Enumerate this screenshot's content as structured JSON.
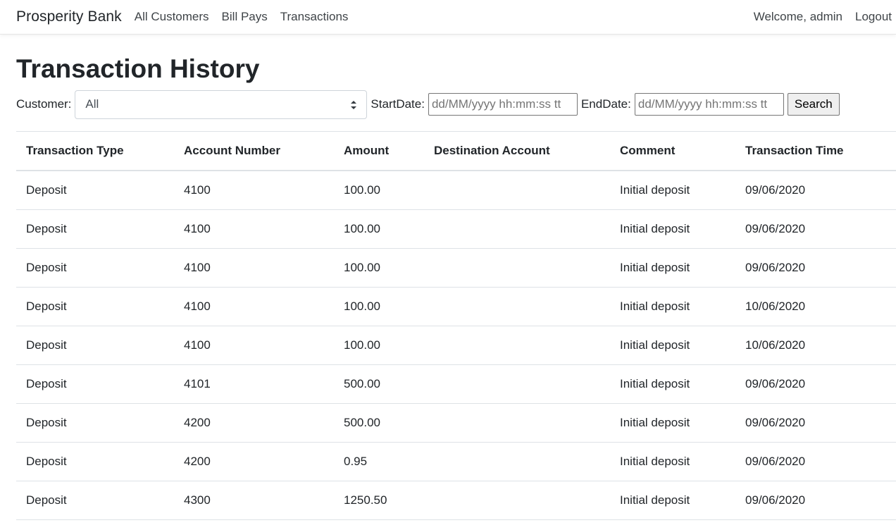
{
  "navbar": {
    "brand": "Prosperity Bank",
    "links": [
      "All Customers",
      "Bill Pays",
      "Transactions"
    ],
    "welcome": "Welcome, admin",
    "logout": "Logout"
  },
  "page": {
    "title": "Transaction History"
  },
  "filters": {
    "customer_label": "Customer:",
    "customer_selected": "All",
    "start_label": "StartDate:",
    "start_placeholder": "dd/MM/yyyy hh:mm:ss tt",
    "end_label": "EndDate:",
    "end_placeholder": "dd/MM/yyyy hh:mm:ss tt",
    "search_label": "Search"
  },
  "table": {
    "headers": [
      "Transaction Type",
      "Account Number",
      "Amount",
      "Destination Account",
      "Comment",
      "Transaction Time"
    ],
    "rows": [
      [
        "Deposit",
        "4100",
        "100.00",
        "",
        "Initial deposit",
        "09/06/2020"
      ],
      [
        "Deposit",
        "4100",
        "100.00",
        "",
        "Initial deposit",
        "09/06/2020"
      ],
      [
        "Deposit",
        "4100",
        "100.00",
        "",
        "Initial deposit",
        "09/06/2020"
      ],
      [
        "Deposit",
        "4100",
        "100.00",
        "",
        "Initial deposit",
        "10/06/2020"
      ],
      [
        "Deposit",
        "4100",
        "100.00",
        "",
        "Initial deposit",
        "10/06/2020"
      ],
      [
        "Deposit",
        "4101",
        "500.00",
        "",
        "Initial deposit",
        "09/06/2020"
      ],
      [
        "Deposit",
        "4200",
        "500.00",
        "",
        "Initial deposit",
        "09/06/2020"
      ],
      [
        "Deposit",
        "4200",
        "0.95",
        "",
        "Initial deposit",
        "09/06/2020"
      ],
      [
        "Deposit",
        "4300",
        "1250.50",
        "",
        "Initial deposit",
        "09/06/2020"
      ]
    ]
  },
  "icons": {
    "select_arrow": "select-arrow-icon"
  }
}
